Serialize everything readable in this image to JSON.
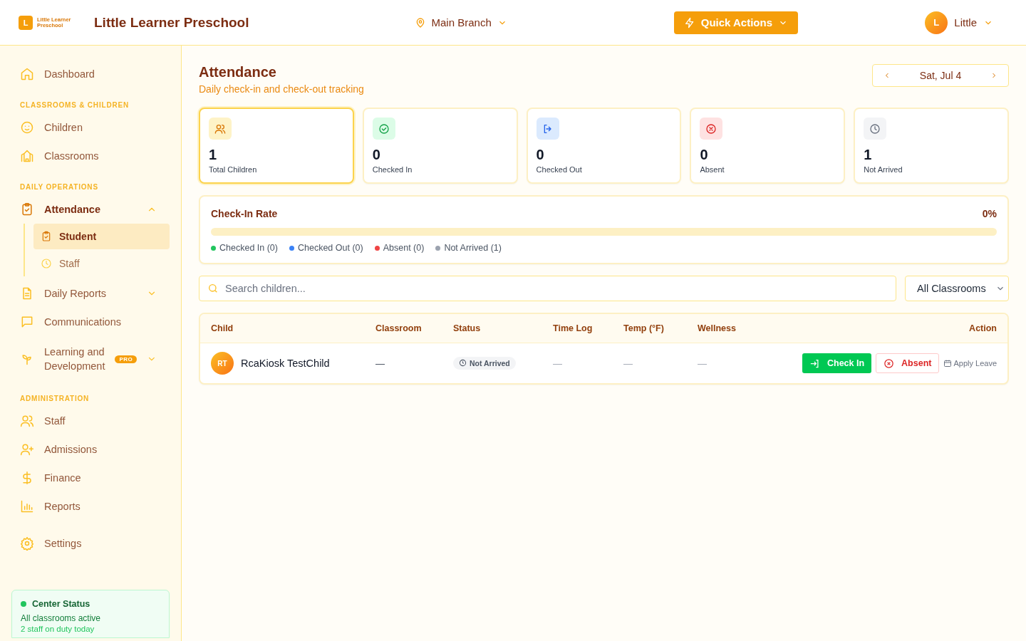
{
  "header": {
    "logo_mark": "L",
    "logo_text": "Little Learner Preschool",
    "title": "Little Learner Preschool",
    "branch": "Main Branch",
    "quick_actions": "Quick Actions",
    "user": {
      "initial": "L",
      "name": "Little"
    }
  },
  "sidebar": {
    "sections": [
      {
        "items": [
          {
            "label": "Dashboard",
            "selected": false
          }
        ]
      },
      {
        "heading": "CLASSROOMS & CHILDREN",
        "items": [
          {
            "label": "Children",
            "selected": false
          },
          {
            "label": "Classrooms",
            "selected": false
          }
        ]
      },
      {
        "heading": "DAILY OPERATIONS",
        "items": [
          {
            "label": "Attendance",
            "selected": false,
            "expanded": true,
            "children": [
              {
                "label": "Student",
                "selected": true
              },
              {
                "label": "Staff",
                "selected": false
              }
            ]
          },
          {
            "label": "Daily Reports",
            "selected": false,
            "expanded": false
          },
          {
            "label": "Communications",
            "selected": false
          },
          {
            "label": "Learning and Development",
            "selected": false,
            "expanded": false,
            "badge": "PRO"
          }
        ]
      },
      {
        "heading": "ADMINISTRATION",
        "items": [
          {
            "label": "Staff",
            "selected": false
          },
          {
            "label": "Admissions",
            "selected": false
          },
          {
            "label": "Finance",
            "selected": false
          },
          {
            "label": "Reports",
            "selected": false
          }
        ]
      },
      {
        "items": [
          {
            "label": "Settings",
            "selected": false
          }
        ]
      }
    ],
    "center_status": {
      "title": "Center Status",
      "line_1": "All classrooms active",
      "line_2": "2 staff on duty today"
    }
  },
  "page": {
    "title": "Attendance",
    "subtitle": "Daily check-in and check-out tracking",
    "date": "Sat, Jul 4"
  },
  "stats": [
    {
      "kind": "total",
      "value": "1",
      "label": "Total Children",
      "selected": true
    },
    {
      "kind": "in",
      "value": "0",
      "label": "Checked In",
      "selected": false
    },
    {
      "kind": "out",
      "value": "0",
      "label": "Checked Out",
      "selected": false
    },
    {
      "kind": "absent",
      "value": "0",
      "label": "Absent",
      "selected": false
    },
    {
      "kind": "pending",
      "value": "1",
      "label": "Not Arrived",
      "selected": false
    }
  ],
  "check_in_rate": {
    "title": "Check-In Rate",
    "reading": "0%",
    "level": 0,
    "legend": [
      {
        "label": "Checked In (0)",
        "color": "#22c55e"
      },
      {
        "label": "Checked Out (0)",
        "color": "#3b82f6"
      },
      {
        "label": "Absent (0)",
        "color": "#ef4444"
      },
      {
        "label": "Not Arrived (1)",
        "color": "#9ca3af"
      }
    ]
  },
  "filters": {
    "search": {
      "placeholder": "Search children..."
    },
    "classroom": "All Classrooms"
  },
  "table": {
    "columns": [
      "Child",
      "Classroom",
      "Status",
      "Time Log",
      "Temp (°F)",
      "Wellness",
      "Action"
    ],
    "rows": [
      {
        "initials": "RT",
        "name": "RcaKiosk TestChild",
        "classroom": "—",
        "status": "Not Arrived",
        "time_log": "—",
        "temp": "—",
        "wellness": "—",
        "check_in": "Check In",
        "absent": "Absent",
        "apply_leave": "Apply Leave"
      }
    ]
  }
}
